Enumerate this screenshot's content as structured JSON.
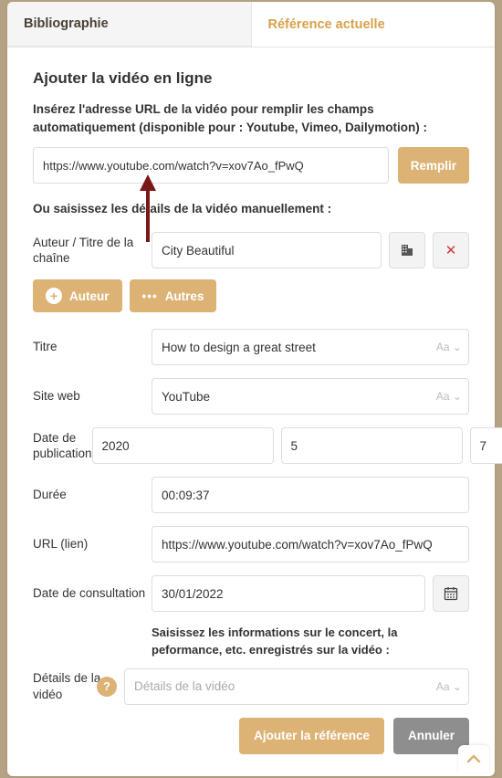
{
  "tabs": {
    "bibliography": "Bibliographie",
    "current": "Référence actuelle"
  },
  "section_title": "Ajouter la vidéo en ligne",
  "url_help": "Insérez l'adresse URL de la vidéo pour remplir les champs automatiquement (disponible pour : Youtube, Vimeo, Dailymotion) :",
  "url_value": "https://www.youtube.com/watch?v=xov7Ao_fPwQ",
  "fill_button": "Remplir",
  "manual_label": "Ou saisissez les détails de la vidéo manuellement :",
  "author": {
    "label": "Auteur / Titre de la chaîne",
    "value": "City Beautiful"
  },
  "pills": {
    "author": "Auteur",
    "others": "Autres"
  },
  "title": {
    "label": "Titre",
    "value": "How to design a great street"
  },
  "website": {
    "label": "Site web",
    "value": "YouTube"
  },
  "pubdate": {
    "label": "Date de publication",
    "year": "2020",
    "month": "5",
    "day": "7"
  },
  "duration": {
    "label": "Durée",
    "value": "00:09:37"
  },
  "url_field": {
    "label": "URL (lien)",
    "value": "https://www.youtube.com/watch?v=xov7Ao_fPwQ"
  },
  "access_date": {
    "label": "Date de consultation",
    "value": "30/01/2022"
  },
  "details_help": "Saisissez les informations sur le concert, la peformance, etc. enregistrés sur la vidéo :",
  "details": {
    "label": "Détails de la vidéo",
    "placeholder": "Détails de la vidéo"
  },
  "footer": {
    "add": "Ajouter la référence",
    "cancel": "Annuler"
  },
  "aa_hint": "Aa ⌄"
}
